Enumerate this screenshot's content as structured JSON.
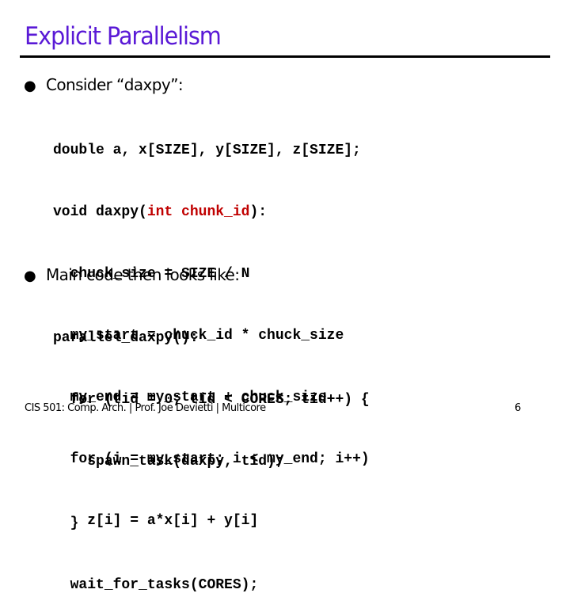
{
  "slide": {
    "title": "Explicit Parallelism",
    "accent_color": "#5a1ad6",
    "highlight_color": "#c00000"
  },
  "bullets": [
    {
      "text": "Consider “daxpy”:",
      "code": [
        {
          "indent": "",
          "pre": "double a, x[SIZE], y[SIZE], z[SIZE];",
          "hl": "",
          "post": ""
        },
        {
          "indent": "",
          "pre": "void daxpy(",
          "hl": "int chunk_id",
          "post": "):"
        },
        {
          "indent": "  ",
          "pre": "chuck_size = SIZE / N",
          "hl": "",
          "post": ""
        },
        {
          "indent": "  ",
          "pre": "my_start = chuck_id * chuck_size",
          "hl": "",
          "post": ""
        },
        {
          "indent": "  ",
          "pre": "my_end = my_start + chuck_size",
          "hl": "",
          "post": ""
        },
        {
          "indent": "  ",
          "pre": "for (i = my_start; i < my_end; i++)",
          "hl": "",
          "post": ""
        },
        {
          "indent": "    ",
          "pre": "z[i] = a*x[i] + y[i]",
          "hl": "",
          "post": ""
        }
      ]
    },
    {
      "text": "Main code then looks like:",
      "code": [
        {
          "indent": "",
          "pre": "parallel_daxpy():",
          "hl": "",
          "post": ""
        },
        {
          "indent": "  ",
          "pre": "for (tid = 0; tid < CORES; tid++) {",
          "hl": "",
          "post": ""
        },
        {
          "indent": "    ",
          "pre": "spawn_task(daxpy, tid);",
          "hl": "",
          "post": ""
        },
        {
          "indent": "  ",
          "pre": "}",
          "hl": "",
          "post": ""
        },
        {
          "indent": "  ",
          "pre": "wait_for_tasks(CORES);",
          "hl": "",
          "post": ""
        }
      ]
    }
  ],
  "footer": {
    "text": "CIS 501: Comp. Arch.  |  Prof. Joe Devietti  |  Multicore",
    "page_number": "6"
  }
}
